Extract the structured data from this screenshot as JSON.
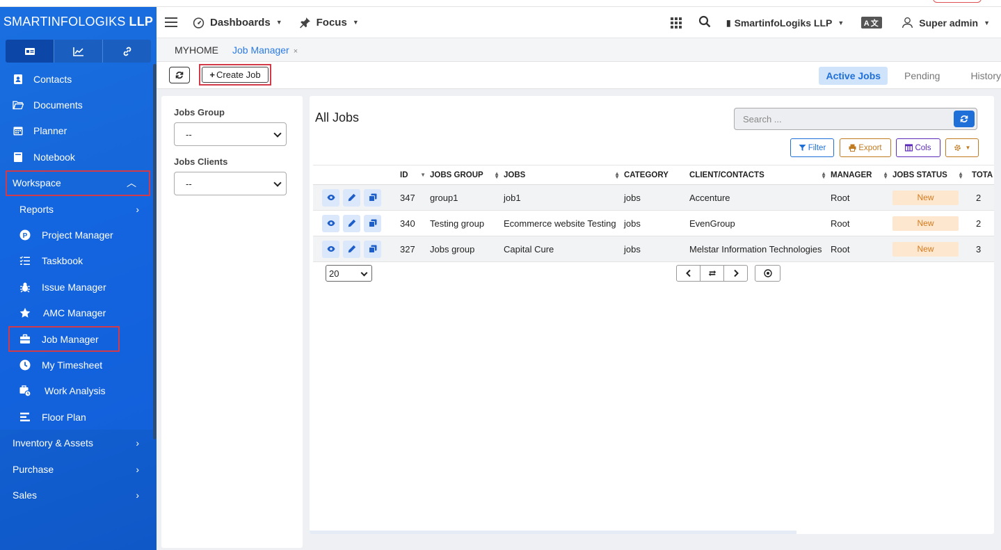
{
  "sidebar": {
    "brand_light": "SMARTINFOLOGIKS",
    "brand_bold": "LLP",
    "tabs": [
      {
        "icon": "id-card-icon"
      },
      {
        "icon": "chart-line-icon"
      },
      {
        "icon": "link-icon"
      }
    ],
    "items": {
      "contacts": "Contacts",
      "documents": "Documents",
      "planner": "Planner",
      "notebook": "Notebook",
      "workspace": "Workspace",
      "reports": "Reports",
      "project_manager": "Project Manager",
      "taskbook": "Taskbook",
      "issue_manager": "Issue Manager",
      "amc_manager": "AMC Manager",
      "job_manager": "Job Manager",
      "my_timesheet": "My Timesheet",
      "work_analysis": "Work Analysis",
      "floor_plan": "Floor Plan",
      "inventory_assets": "Inventory & Assets",
      "purchase": "Purchase",
      "sales": "Sales"
    }
  },
  "header": {
    "dashboards": "Dashboards",
    "focus": "Focus",
    "company": "SmartinfoLogiks LLP",
    "lang": "A文",
    "user": "Super admin"
  },
  "crumbs": {
    "home": "MYHOME",
    "current": "Job Manager",
    "close": "×"
  },
  "toolbar": {
    "create_job": "Create Job",
    "create_plus": "+",
    "status_tabs": [
      "Active Jobs",
      "Pending",
      "History"
    ]
  },
  "filters": {
    "jobs_group_label": "Jobs Group",
    "jobs_group_value": "--",
    "jobs_clients_label": "Jobs Clients",
    "jobs_clients_value": "--"
  },
  "main": {
    "title": "All Jobs",
    "search_placeholder": "Search ...",
    "filter_label": "Filter",
    "export_label": "Export",
    "cols_label": "Cols"
  },
  "table": {
    "headers": [
      "ID",
      "JOBS GROUP",
      "JOBS",
      "CATEGORY",
      "CLIENT/CONTACTS",
      "MANAGER",
      "JOBS STATUS",
      "TOTA"
    ],
    "rows": [
      {
        "id": "347",
        "group": "group1",
        "job": "job1",
        "category": "jobs",
        "client": "Accenture",
        "manager": "Root",
        "status": "New",
        "total": "2"
      },
      {
        "id": "340",
        "group": "Testing group",
        "job": "Ecommerce website Testing",
        "category": "jobs",
        "client": "EvenGroup",
        "manager": "Root",
        "status": "New",
        "total": "2"
      },
      {
        "id": "327",
        "group": "Jobs group",
        "job": "Capital Cure",
        "category": "jobs",
        "client": "Melstar Information Technologies",
        "manager": "Root",
        "status": "New",
        "total": "3"
      }
    ]
  },
  "pager": {
    "page_size": "20"
  },
  "colors": {
    "sidebar_blue": "#1565d8",
    "accent": "#1e6fd8",
    "highlight_border": "#d23a4a",
    "status_new_bg": "#fde7cf",
    "status_new_fg": "#d67a1c"
  }
}
